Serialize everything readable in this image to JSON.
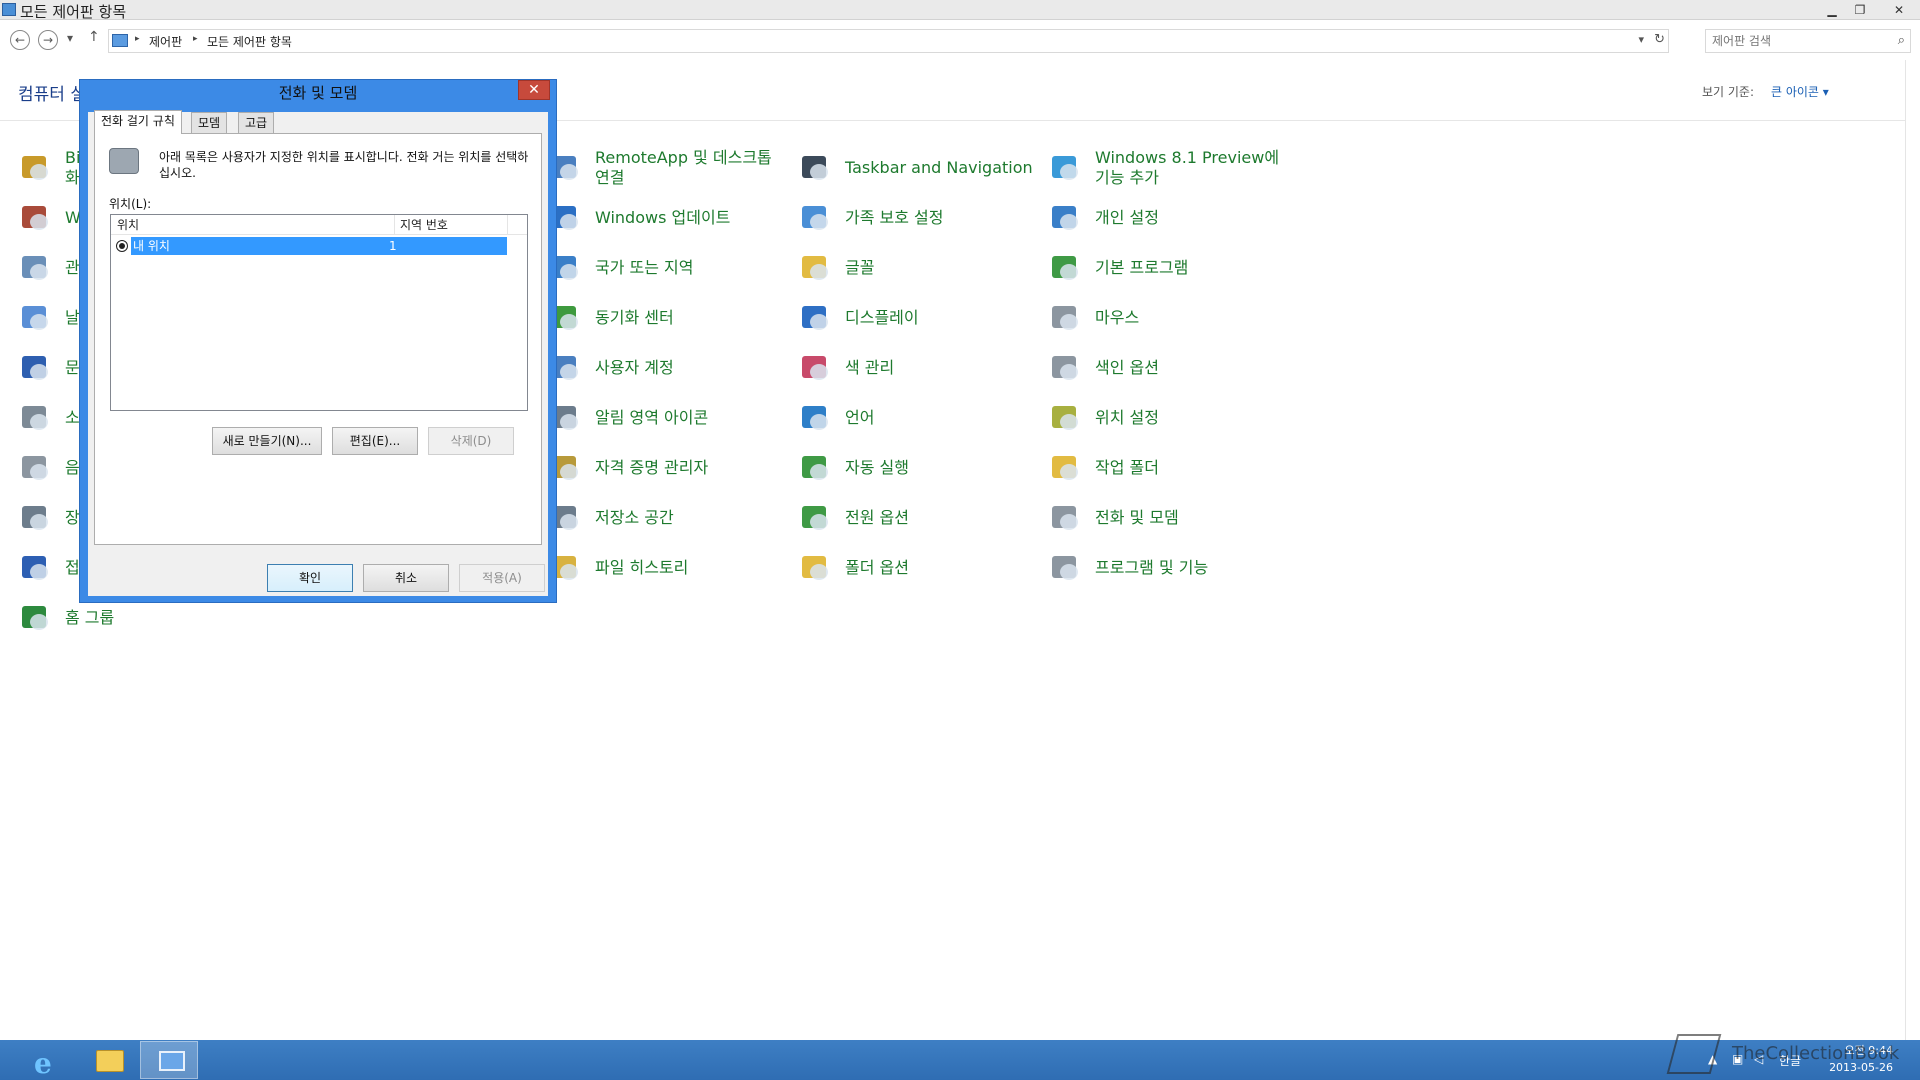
{
  "window": {
    "title": "모든 제어판 항목"
  },
  "breadcrumb": [
    "제어판",
    "모든 제어판 항목"
  ],
  "search": {
    "placeholder": "제어판 검색"
  },
  "header": {
    "title": "컴퓨터 설",
    "view_by_label": "보기 기준:",
    "view_by_value": "큰 아이콘 ▾"
  },
  "items": [
    {
      "label": "Bit\n화",
      "icon": "key-icon",
      "color": "#c89a2a"
    },
    {
      "label": "W",
      "icon": "firewall-icon",
      "color": "#a94b3a"
    },
    {
      "label": "관",
      "icon": "admin-tools-icon",
      "color": "#6a8fb8"
    },
    {
      "label": "날",
      "icon": "calendar-icon",
      "color": "#5a8fd6"
    },
    {
      "label": "문",
      "icon": "troubleshoot-icon",
      "color": "#2e5fb0"
    },
    {
      "label": "소",
      "icon": "speaker-icon",
      "color": "#7d8a96"
    },
    {
      "label": "음",
      "icon": "microphone-icon",
      "color": "#8c96a0"
    },
    {
      "label": "장",
      "icon": "devices-icon",
      "color": "#6d7d8c"
    },
    {
      "label": "접",
      "icon": "ease-of-access-icon",
      "color": "#2d5fb3"
    },
    {
      "label": "홈 그룹",
      "icon": "homegroup-icon",
      "color": "#2d8a3e"
    },
    {
      "label": "RemoteApp 및 데스크톱 연결",
      "icon": "remote-app-icon",
      "color": "#4a7fc0"
    },
    {
      "label": "Windows 업데이트",
      "icon": "windows-update-icon",
      "color": "#2b6fc4"
    },
    {
      "label": "국가 또는 지역",
      "icon": "region-icon",
      "color": "#3a7fc8"
    },
    {
      "label": "동기화 센터",
      "icon": "sync-center-icon",
      "color": "#3e9a3e"
    },
    {
      "label": "사용자 계정",
      "icon": "user-accounts-icon",
      "color": "#4a7fc0"
    },
    {
      "label": "알림 영역 아이콘",
      "icon": "notification-icon",
      "color": "#6c7c8c"
    },
    {
      "label": "자격 증명 관리자",
      "icon": "credential-icon",
      "color": "#b89a3a"
    },
    {
      "label": "저장소 공간",
      "icon": "storage-icon",
      "color": "#6c7c8c"
    },
    {
      "label": "파일 히스토리",
      "icon": "file-history-icon",
      "color": "#d8b240"
    },
    {
      "label": "Taskbar and Navigation",
      "icon": "taskbar-icon",
      "color": "#3c4a5a"
    },
    {
      "label": "가족 보호 설정",
      "icon": "family-safety-icon",
      "color": "#4a8fd6"
    },
    {
      "label": "글꼴",
      "icon": "fonts-icon",
      "color": "#e2bb42"
    },
    {
      "label": "디스플레이",
      "icon": "display-icon",
      "color": "#2e6fc4"
    },
    {
      "label": "색 관리",
      "icon": "color-management-icon",
      "color": "#c84a6a"
    },
    {
      "label": "언어",
      "icon": "language-icon",
      "color": "#2e7fc8"
    },
    {
      "label": "자동 실행",
      "icon": "autoplay-icon",
      "color": "#3f9a45"
    },
    {
      "label": "전원 옵션",
      "icon": "power-options-icon",
      "color": "#3f9a45"
    },
    {
      "label": "폴더 옵션",
      "icon": "folder-options-icon",
      "color": "#e2bb42"
    },
    {
      "label": "Windows 8.1 Preview에 기능 추가",
      "icon": "add-features-icon",
      "color": "#3a9ad8"
    },
    {
      "label": "개인 설정",
      "icon": "personalization-icon",
      "color": "#3a7fc8"
    },
    {
      "label": "기본 프로그램",
      "icon": "default-programs-icon",
      "color": "#3f9a45"
    },
    {
      "label": "마우스",
      "icon": "mouse-icon",
      "color": "#8c96a0"
    },
    {
      "label": "색인 옵션",
      "icon": "indexing-icon",
      "color": "#8c96a0"
    },
    {
      "label": "위치 설정",
      "icon": "location-icon",
      "color": "#a8b040"
    },
    {
      "label": "작업 폴더",
      "icon": "work-folders-icon",
      "color": "#e2bb42"
    },
    {
      "label": "전화 및 모뎀",
      "icon": "phone-modem-icon",
      "color": "#8c96a0"
    },
    {
      "label": "프로그램 및 기능",
      "icon": "programs-icon",
      "color": "#8c96a0"
    }
  ],
  "dialog": {
    "title": "전화 및 모뎀",
    "tabs": [
      "전화 걸기 규칙",
      "모뎀",
      "고급"
    ],
    "description": "아래 목록은 사용자가 지정한 위치를 표시합니다. 전화 거는 위치를 선택하십시오.",
    "location_label": "위치(L):",
    "columns": [
      "위치",
      "지역 번호"
    ],
    "rows": [
      {
        "location": "내 위치",
        "area_code": "1"
      }
    ],
    "buttons": {
      "new": "새로 만들기(N)...",
      "edit": "편집(E)...",
      "delete": "삭제(D)",
      "ok": "확인",
      "cancel": "취소",
      "apply": "적용(A)"
    }
  },
  "taskbar": {
    "tray": {
      "ime": "한글",
      "time": "오전 9:44",
      "date": "2013-05-26"
    }
  },
  "watermark": "TheCollectionBook"
}
